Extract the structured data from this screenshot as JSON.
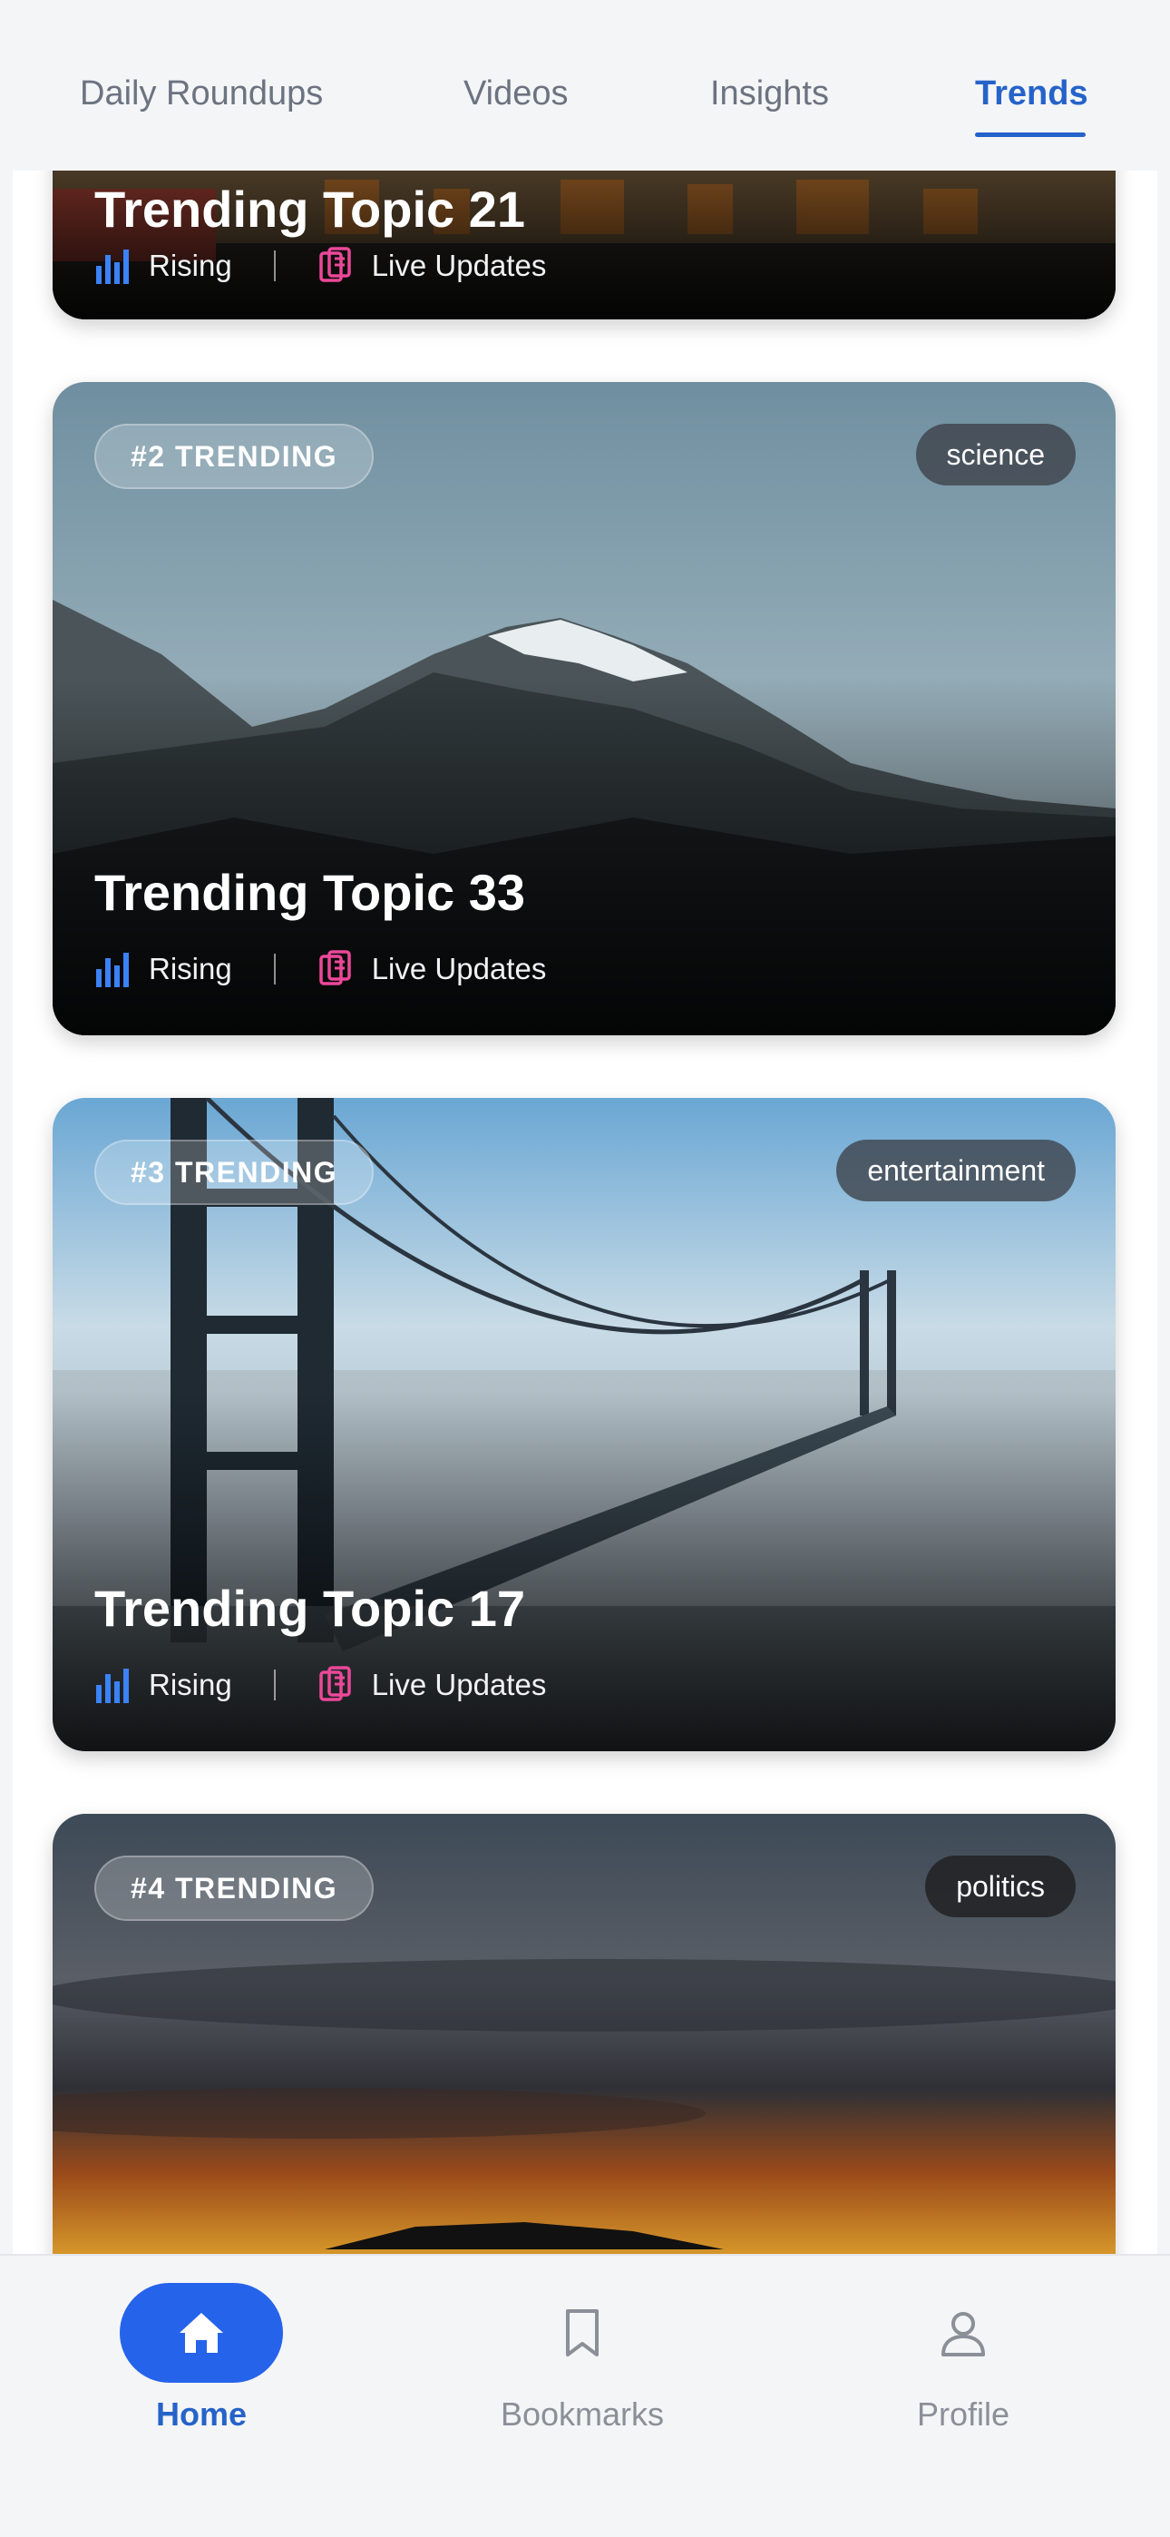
{
  "tabs": [
    {
      "label": "Daily Roundups",
      "active": false
    },
    {
      "label": "Videos",
      "active": false
    },
    {
      "label": "Insights",
      "active": false
    },
    {
      "label": "Trends",
      "active": true
    }
  ],
  "cards": [
    {
      "rank": "",
      "category": "",
      "title": "Trending Topic 21",
      "status": "Rising",
      "updates": "Live Updates",
      "image": "street-scene"
    },
    {
      "rank": "#2 TRENDING",
      "category": "science",
      "title": "Trending Topic 33",
      "status": "Rising",
      "updates": "Live Updates",
      "image": "mountain"
    },
    {
      "rank": "#3 TRENDING",
      "category": "entertainment",
      "title": "Trending Topic 17",
      "status": "Rising",
      "updates": "Live Updates",
      "image": "bridge-in-fog"
    },
    {
      "rank": "#4 TRENDING",
      "category": "politics",
      "title": "",
      "status": "",
      "updates": "",
      "image": "sunset-sky"
    }
  ],
  "icons": {
    "rising": "bar-chart-icon",
    "updates": "documents-icon"
  },
  "colors": {
    "accent": "#2563c9",
    "rising_icon": "#3b82f6",
    "updates_icon": "#ec4899"
  },
  "nav": [
    {
      "label": "Home",
      "icon": "home-icon",
      "active": true
    },
    {
      "label": "Bookmarks",
      "icon": "bookmark-icon",
      "active": false
    },
    {
      "label": "Profile",
      "icon": "user-icon",
      "active": false
    }
  ]
}
